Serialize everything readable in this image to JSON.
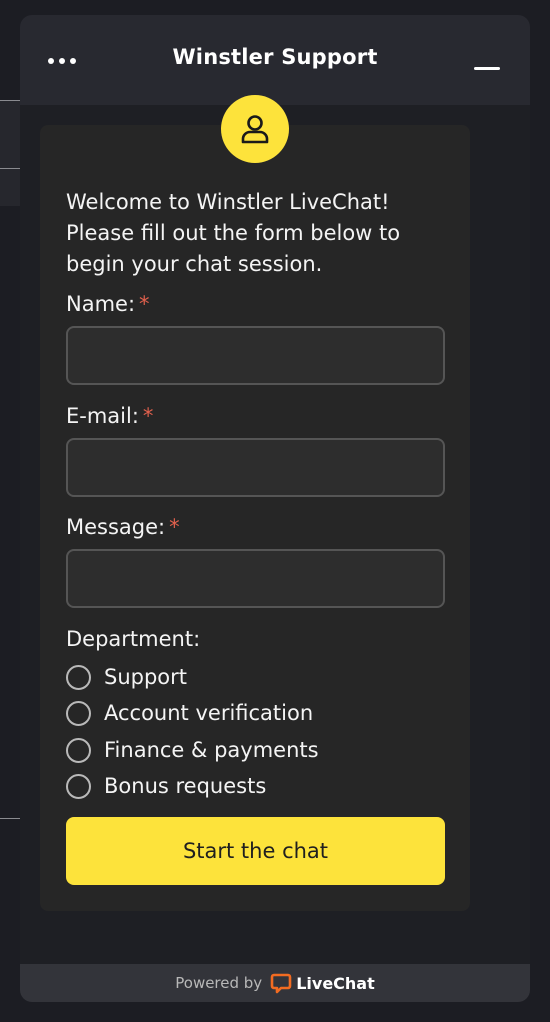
{
  "header": {
    "title": "Winstler Support",
    "menu_icon": "more-horizontal-icon",
    "minimize_icon": "minimize-icon"
  },
  "form": {
    "avatar_icon": "user-icon",
    "intro": "Welcome to Winstler LiveChat! Please fill out the form below to begin your chat session.",
    "name_label": "Name:",
    "email_label": "E-mail:",
    "message_label": "Message:",
    "required_marker": "*",
    "name_value": "",
    "email_value": "",
    "message_value": "",
    "department_label": "Department:",
    "departments": [
      "Support",
      "Account verification",
      "Finance & payments",
      "Bonus requests"
    ],
    "submit_label": "Start the chat"
  },
  "footer": {
    "powered_by": "Powered by",
    "brand": "LiveChat",
    "brand_icon": "livechat-logo-icon"
  },
  "colors": {
    "accent": "#fde33b",
    "required": "#e0604d",
    "brand": "#f26b21"
  }
}
